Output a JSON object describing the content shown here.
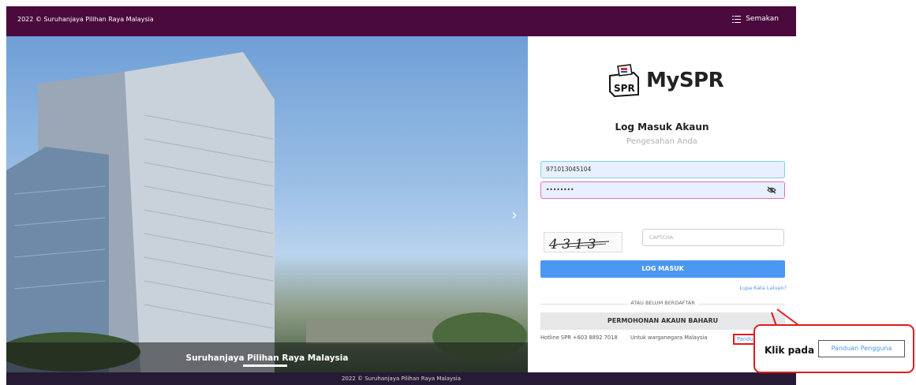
{
  "topbar": {
    "copyright": "2022 © Suruhanjaya Pilihan Raya Malaysia",
    "semakan_label": "Semakan"
  },
  "hero": {
    "caption": "Suruhanjaya Pilihan Raya Malaysia"
  },
  "panel": {
    "logo_text": "MySPR",
    "title": "Log Masuk Akaun",
    "subtitle": "Pengesahan Anda",
    "id_value": "971013045104",
    "password_value": "••••••••",
    "captcha_text": "4 3 1 3",
    "captcha_placeholder": "CAPTCHA",
    "login_label": "LOG MASUK",
    "forgot_label": "Lupa Kata Laluan?",
    "divider_text": "ATAU BELUM BERDAFTAR",
    "apply_label": "PERMOHONAN AKAUN BAHARU",
    "hotline": "Hotline SPR +603 8892 7018",
    "citizen": "Untuk warganegara Malaysia",
    "panduan_label": "Panduan Pengguna"
  },
  "footer": {
    "copyright": "2022 © Suruhanjaya Pilihan Raya Malaysia"
  },
  "callout": {
    "klik_label": "Klik pada",
    "panduan_label": "Panduan Pengguna"
  },
  "colors": {
    "topbar": "#4a0a3d",
    "primary": "#4a98f1",
    "highlight": "#e21b1b",
    "bottombar": "#271a35"
  }
}
